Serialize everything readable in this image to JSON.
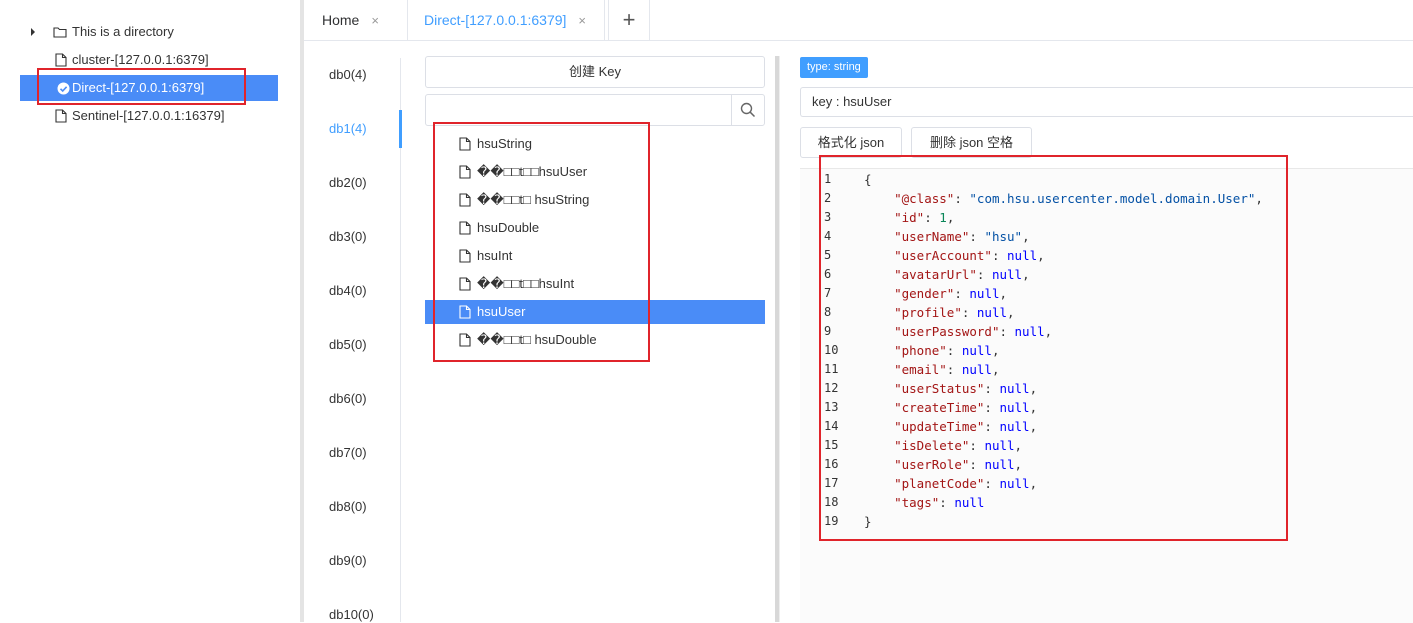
{
  "tree": {
    "items": [
      {
        "label": "This is a directory",
        "icon": "folder-icon",
        "expander": "caret-right-icon"
      },
      {
        "label": "cluster-[127.0.0.1:6379]",
        "icon": "file-icon"
      },
      {
        "label": "Direct-[127.0.0.1:6379]",
        "icon": "check-circle-icon",
        "selected": true
      },
      {
        "label": "Sentinel-[127.0.0.1:16379]",
        "icon": "file-icon"
      }
    ]
  },
  "tabs": [
    {
      "label": "Home",
      "close": "×"
    },
    {
      "label": "Direct-[127.0.0.1:6379]",
      "close": "×",
      "active": true
    },
    {
      "label": "+"
    }
  ],
  "dbs": [
    "db0(4)",
    "db1(4)",
    "db2(0)",
    "db3(0)",
    "db4(0)",
    "db5(0)",
    "db6(0)",
    "db7(0)",
    "db8(0)",
    "db9(0)",
    "db10(0)"
  ],
  "active_db": "db1(4)",
  "keylist": {
    "create_label": "创建 Key",
    "search_placeholder": "",
    "keys": [
      "hsuString",
      "��\u0000\u0005t\u0000\u0007hsuUser",
      "��\u0000\u0005t\u0000 hsuString",
      "hsuDouble",
      "hsuInt",
      "��\u0000\u0005t\u0000\u0006hsuInt",
      "hsuUser",
      "��\u0000\u0005t\u0000 hsuDouble"
    ],
    "keys_display": [
      "hsuString",
      "��□□t□□hsuUser",
      "��□□t□ hsuString",
      "hsuDouble",
      "hsuInt",
      "��□□t□□hsuInt",
      "hsuUser",
      "��□□t□ hsuDouble"
    ],
    "selected": "hsuUser"
  },
  "detail": {
    "type_tag": "type: string",
    "key_field": "key : hsuUser",
    "format_json_label": "格式化 json",
    "remove_spaces_label": "删除 json 空格",
    "line_numbers": [
      "1",
      "2",
      "3",
      "4",
      "5",
      "6",
      "7",
      "8",
      "9",
      "10",
      "11",
      "12",
      "13",
      "14",
      "15",
      "16",
      "17",
      "18",
      "19"
    ],
    "json_lines": [
      "{",
      "    \"@class\": \"com.hsu.usercenter.model.domain.User\",",
      "    \"id\": 1,",
      "    \"userName\": \"hsu\",",
      "    \"userAccount\": null,",
      "    \"avatarUrl\": null,",
      "    \"gender\": null,",
      "    \"profile\": null,",
      "    \"userPassword\": null,",
      "    \"phone\": null,",
      "    \"email\": null,",
      "    \"userStatus\": null,",
      "    \"createTime\": null,",
      "    \"updateTime\": null,",
      "    \"isDelete\": null,",
      "    \"userRole\": null,",
      "    \"planetCode\": null,",
      "    \"tags\": null",
      "}"
    ]
  },
  "colors": {
    "accent": "#409eff",
    "selection": "#4a8cf7",
    "annotation": "#e0242b"
  }
}
